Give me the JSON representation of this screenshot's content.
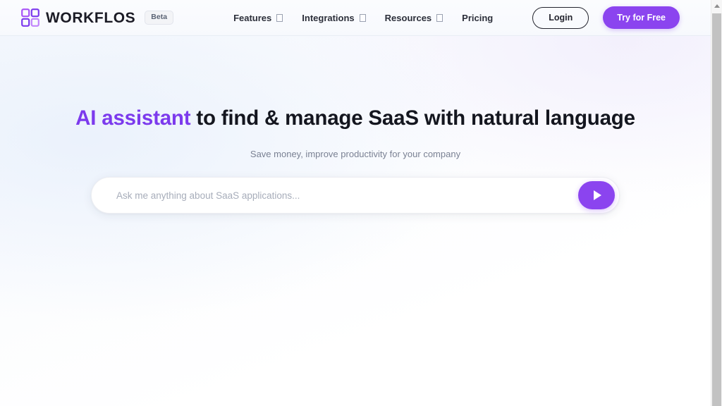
{
  "header": {
    "brand": {
      "name": "WORKFLOS",
      "badge": "Beta",
      "logo_icon": "grid-squares-logo-icon"
    },
    "nav": [
      {
        "label": "Features",
        "has_dropdown": true,
        "icon": "chevron-down-icon"
      },
      {
        "label": "Integrations",
        "has_dropdown": true,
        "icon": "chevron-down-icon"
      },
      {
        "label": "Resources",
        "has_dropdown": true,
        "icon": "chevron-down-icon"
      },
      {
        "label": "Pricing",
        "has_dropdown": false,
        "icon": ""
      }
    ],
    "login_label": "Login",
    "try_label": "Try for Free"
  },
  "hero": {
    "headline_accent": "AI assistant",
    "headline_rest": " to find & manage SaaS with natural language",
    "subhead": "Save money, improve productivity for your company"
  },
  "search": {
    "value": "",
    "placeholder": "Ask me anything about SaaS applications...",
    "send_icon": "send-play-icon"
  },
  "scrollbar": {
    "up_arrow_icon": "scroll-up-arrow-icon",
    "thumb": "scrollbar-thumb"
  },
  "colors": {
    "accent_purple": "#8b44ef",
    "headline_accent": "#7c3aed",
    "text_dark": "#14161f",
    "text_muted": "#7a8193",
    "placeholder": "#a7adba",
    "page_bg": "#fbfcfe",
    "scrollbar_track": "#f6f6f6",
    "scrollbar_thumb": "#c2c2c2"
  }
}
